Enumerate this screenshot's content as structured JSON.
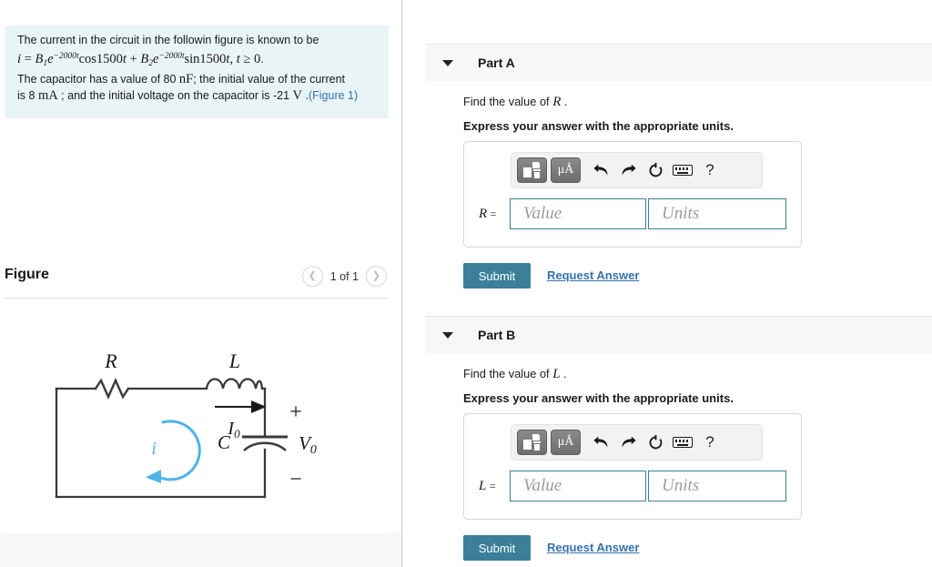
{
  "problem": {
    "line1": "The current in the circuit in the followin figure is known to be",
    "equation_plain": "i = B1e^-2000t cos1500t + B2e^-2000t sin1500t, t ≥ 0.",
    "line3_a": "The capacitor has a value of 80",
    "line3_unit": "nF",
    "line3_b": "; the initial value of the current",
    "line4_a": "is 8",
    "line4_unit": "mA",
    "line4_b": "; and the initial voltage on the capacitor is -21",
    "line4_unit2": "V",
    "line4_c": ".",
    "figure_link": "(Figure 1)"
  },
  "figure": {
    "title": "Figure",
    "pager_label": "1 of 1",
    "prev_icon": "chevron-left-icon",
    "next_icon": "chevron-right-icon",
    "circuit": {
      "resistor_label": "R",
      "inductor_label": "L",
      "current_arrow_label": "I0",
      "capacitor_label": "C",
      "voltage_label": "V0",
      "plus_sign": "+",
      "minus_sign": "−",
      "mesh_current_label": "i",
      "mesh_current_color": "#4FB3E8"
    }
  },
  "parts": [
    {
      "id": "part-a",
      "title": "Part A",
      "question_prefix": "Find the value of",
      "question_symbol": "R",
      "question_suffix": ".",
      "instruction": "Express your answer with the appropriate units.",
      "equation_label": "R",
      "equation_equals": "=",
      "value_placeholder": "Value",
      "units_placeholder": "Units",
      "value_current": "",
      "units_current": "",
      "submit_label": "Submit",
      "request_answer_label": "Request Answer"
    },
    {
      "id": "part-b",
      "title": "Part B",
      "question_prefix": "Find the value of",
      "question_symbol": "L",
      "question_suffix": ".",
      "instruction": "Express your answer with the appropriate units.",
      "equation_label": "L",
      "equation_equals": "=",
      "value_placeholder": "Value",
      "units_placeholder": "Units",
      "value_current": "",
      "units_current": "",
      "submit_label": "Submit",
      "request_answer_label": "Request Answer"
    }
  ],
  "mathbar": {
    "template_button_label": "",
    "units_button_label": "μÅ",
    "undo_glyph": "↰",
    "redo_glyph": "↱",
    "reset_glyph": "↻",
    "keyboard_label": "",
    "help_glyph": "?"
  },
  "colors": {
    "accent": "#3b7f98",
    "link": "#3572b0",
    "problem_bg": "#e9f4f6",
    "header_bg": "#f7f7f7",
    "divider": "#c3ced6"
  }
}
